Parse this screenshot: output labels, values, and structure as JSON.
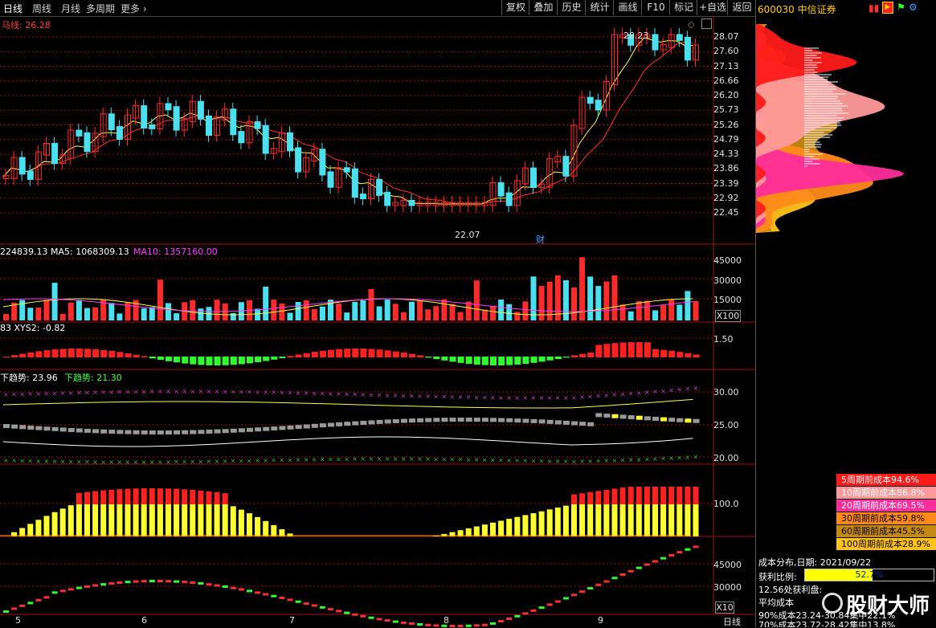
{
  "toolbar": {
    "tabs": [
      "日线",
      "周线",
      "月线",
      "多周期",
      "更多"
    ],
    "right_buttons": [
      "复权",
      "叠加",
      "历史",
      "统计",
      "画线",
      "F10",
      "标记",
      "+自选",
      "返回"
    ]
  },
  "stock": {
    "code_name": "600030 中信证券"
  },
  "main_chart": {
    "indicator_label": "马线: 26.28",
    "price_ticks": [
      "28.07",
      "27.60",
      "27.13",
      "26.66",
      "26.20",
      "25.73",
      "25.26",
      "24.79",
      "24.33",
      "23.86",
      "23.39",
      "22.92",
      "22.45"
    ],
    "high_label": "28.23",
    "low_label": "22.07",
    "event_marker": "财"
  },
  "volume_panel": {
    "label_vol": "224839.13",
    "label_ma5": "MA5: 1068309.13",
    "label_ma10": "MA10: 1357160.00",
    "ticks": [
      "45000",
      "30000",
      "15000"
    ],
    "unit": "X100"
  },
  "xys_panel": {
    "label": "83 XYS2: -0.82",
    "tick": "1.50"
  },
  "trend_panel": {
    "label_a": "下趋势: 23.96",
    "label_b": "下趋势: 21.30",
    "ticks": [
      "30.00",
      "25.00",
      "20.00"
    ]
  },
  "bar_panel": {
    "tick": "100.0"
  },
  "cost_line_panel": {
    "ticks": [
      "45000",
      "30000"
    ],
    "unit": "X10"
  },
  "date_axis": {
    "labels": [
      "5",
      "6",
      "7",
      "8",
      "9"
    ],
    "period": "日线"
  },
  "cost_legend": [
    {
      "text": "5周期前成本94.6%",
      "bg": "#ff1a1a",
      "fg": "#ffffff"
    },
    {
      "text": "10周期前成本86.8%",
      "bg": "#ff9a9a",
      "fg": "#ffffff"
    },
    {
      "text": "20周期前成本69.5%",
      "bg": "#ff2d9b",
      "fg": "#ffffff"
    },
    {
      "text": "30周期前成本59.8%",
      "bg": "#ff8a1a",
      "fg": "#000000"
    },
    {
      "text": "60周期前成本45.5%",
      "bg": "#c78a10",
      "fg": "#000000"
    },
    {
      "text": "100周期前成本28.9%",
      "bg": "#ffc21a",
      "fg": "#000000"
    }
  ],
  "cost_info": {
    "date_line": "成本分布,日期: 2021/09/22",
    "profit_label": "获利比例:",
    "profit_value": "52.7%",
    "profit_ratio": 0.527,
    "line3": "12.56处获利盘:",
    "line4": "平均成本",
    "line5": "90%成本23.24-30.84集中22.1%",
    "line6": "70%成本23.72-28.42集中13.8%"
  },
  "watermark": "股财大师",
  "colors": {
    "up": "#ff2a2a",
    "down": "#4ae0f0",
    "grid": "#9b1010",
    "ma5": "#ffffff",
    "ma10": "#ffff30",
    "ma20": "#ff30ff"
  }
}
